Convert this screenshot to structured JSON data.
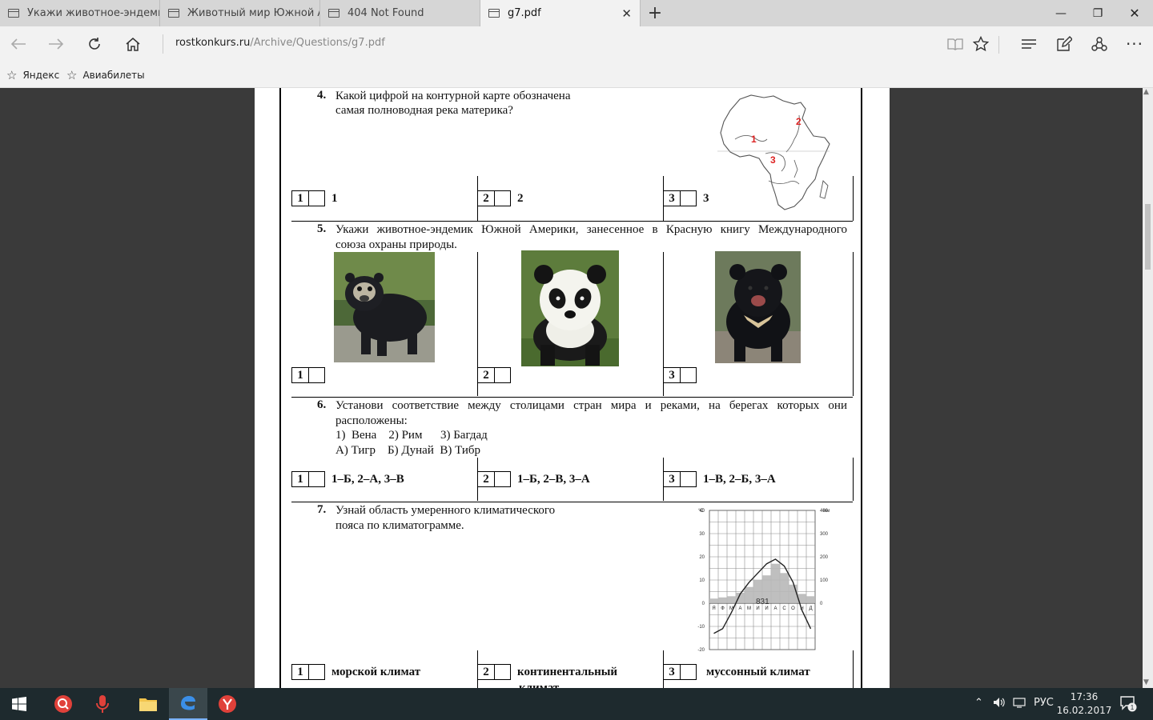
{
  "browser": {
    "tabs": [
      {
        "title": "Укажи животное-эндемик"
      },
      {
        "title": "Животный мир Южной Ам"
      },
      {
        "title": "404 Not Found"
      },
      {
        "title": "g7.pdf"
      }
    ],
    "url_domain": "rostkonkurs.ru",
    "url_path": "/Archive/Questions/g7.pdf",
    "favorites": [
      "Яндекс",
      "Авиабилеты"
    ]
  },
  "document": {
    "q4": {
      "number": "4.",
      "line1": "Какой цифрой на контурной карте обозначена",
      "line2": "самая полноводная река материка?",
      "map_labels": [
        "1",
        "2",
        "3"
      ],
      "answers": [
        {
          "num": "1",
          "text": "1"
        },
        {
          "num": "2",
          "text": "2"
        },
        {
          "num": "3",
          "text": "3"
        }
      ]
    },
    "q5": {
      "number": "5.",
      "line1": "Укажи животное-эндемик  Южной Америки, занесенное в Красную книгу Международного",
      "line2": "союза охраны природы.",
      "answers": [
        {
          "num": "1"
        },
        {
          "num": "2"
        },
        {
          "num": "3"
        }
      ]
    },
    "q6": {
      "number": "6.",
      "line1": "Установи соответствие между столицами стран мира  и реками, на берегах которых они",
      "line2": "расположены:",
      "line3": "1)  Вена    2) Рим      3) Багдад",
      "line4": "А) Тигр    Б) Дунай  В) Тибр",
      "answers": [
        {
          "num": "1",
          "text": "1–Б, 2–А, 3–В"
        },
        {
          "num": "2",
          "text": "1–Б, 2–В, 3–А"
        },
        {
          "num": "3",
          "text": "1–В, 2–Б, 3–А"
        }
      ]
    },
    "q7": {
      "number": "7.",
      "line1": "Узнай область умеренного климатического",
      "line2": "пояса по климатограмме.",
      "answers": [
        {
          "num": "1",
          "text": "морской климат"
        },
        {
          "num": "2",
          "text": "континентальный",
          "text2": "климат"
        },
        {
          "num": "3",
          "text": "муссонный климат"
        }
      ],
      "climatogram": {
        "unit_left": "°C",
        "unit_right": "мм",
        "temp_ticks": [
          "40",
          "30",
          "20",
          "10",
          "0",
          "-10",
          "-20"
        ],
        "precip_ticks": [
          "400",
          "300",
          "200",
          "100",
          "0"
        ],
        "months": [
          "Я",
          "Ф",
          "М",
          "А",
          "М",
          "И",
          "И",
          "А",
          "С",
          "О",
          "Н",
          "Д"
        ],
        "annual_precip": "831"
      }
    }
  },
  "taskbar": {
    "lang": "РУС",
    "time": "17:36",
    "date": "16.02.2017",
    "notifications": "1"
  },
  "chart_data": {
    "type": "bar",
    "categories": [
      "Я",
      "Ф",
      "М",
      "А",
      "М",
      "И",
      "И",
      "А",
      "С",
      "О",
      "Н",
      "Д"
    ],
    "series": [
      {
        "values": [
          20,
          25,
          30,
          45,
          70,
          100,
          120,
          170,
          130,
          80,
          40,
          30
        ]
      },
      {
        "values": [
          -13,
          -11,
          -4,
          4,
          9,
          13,
          17,
          19,
          16,
          9,
          -3,
          -11
        ]
      }
    ],
    "ylim_temp": [
      -20,
      40
    ],
    "ylim_precip": [
      0,
      400
    ],
    "grid": true
  }
}
